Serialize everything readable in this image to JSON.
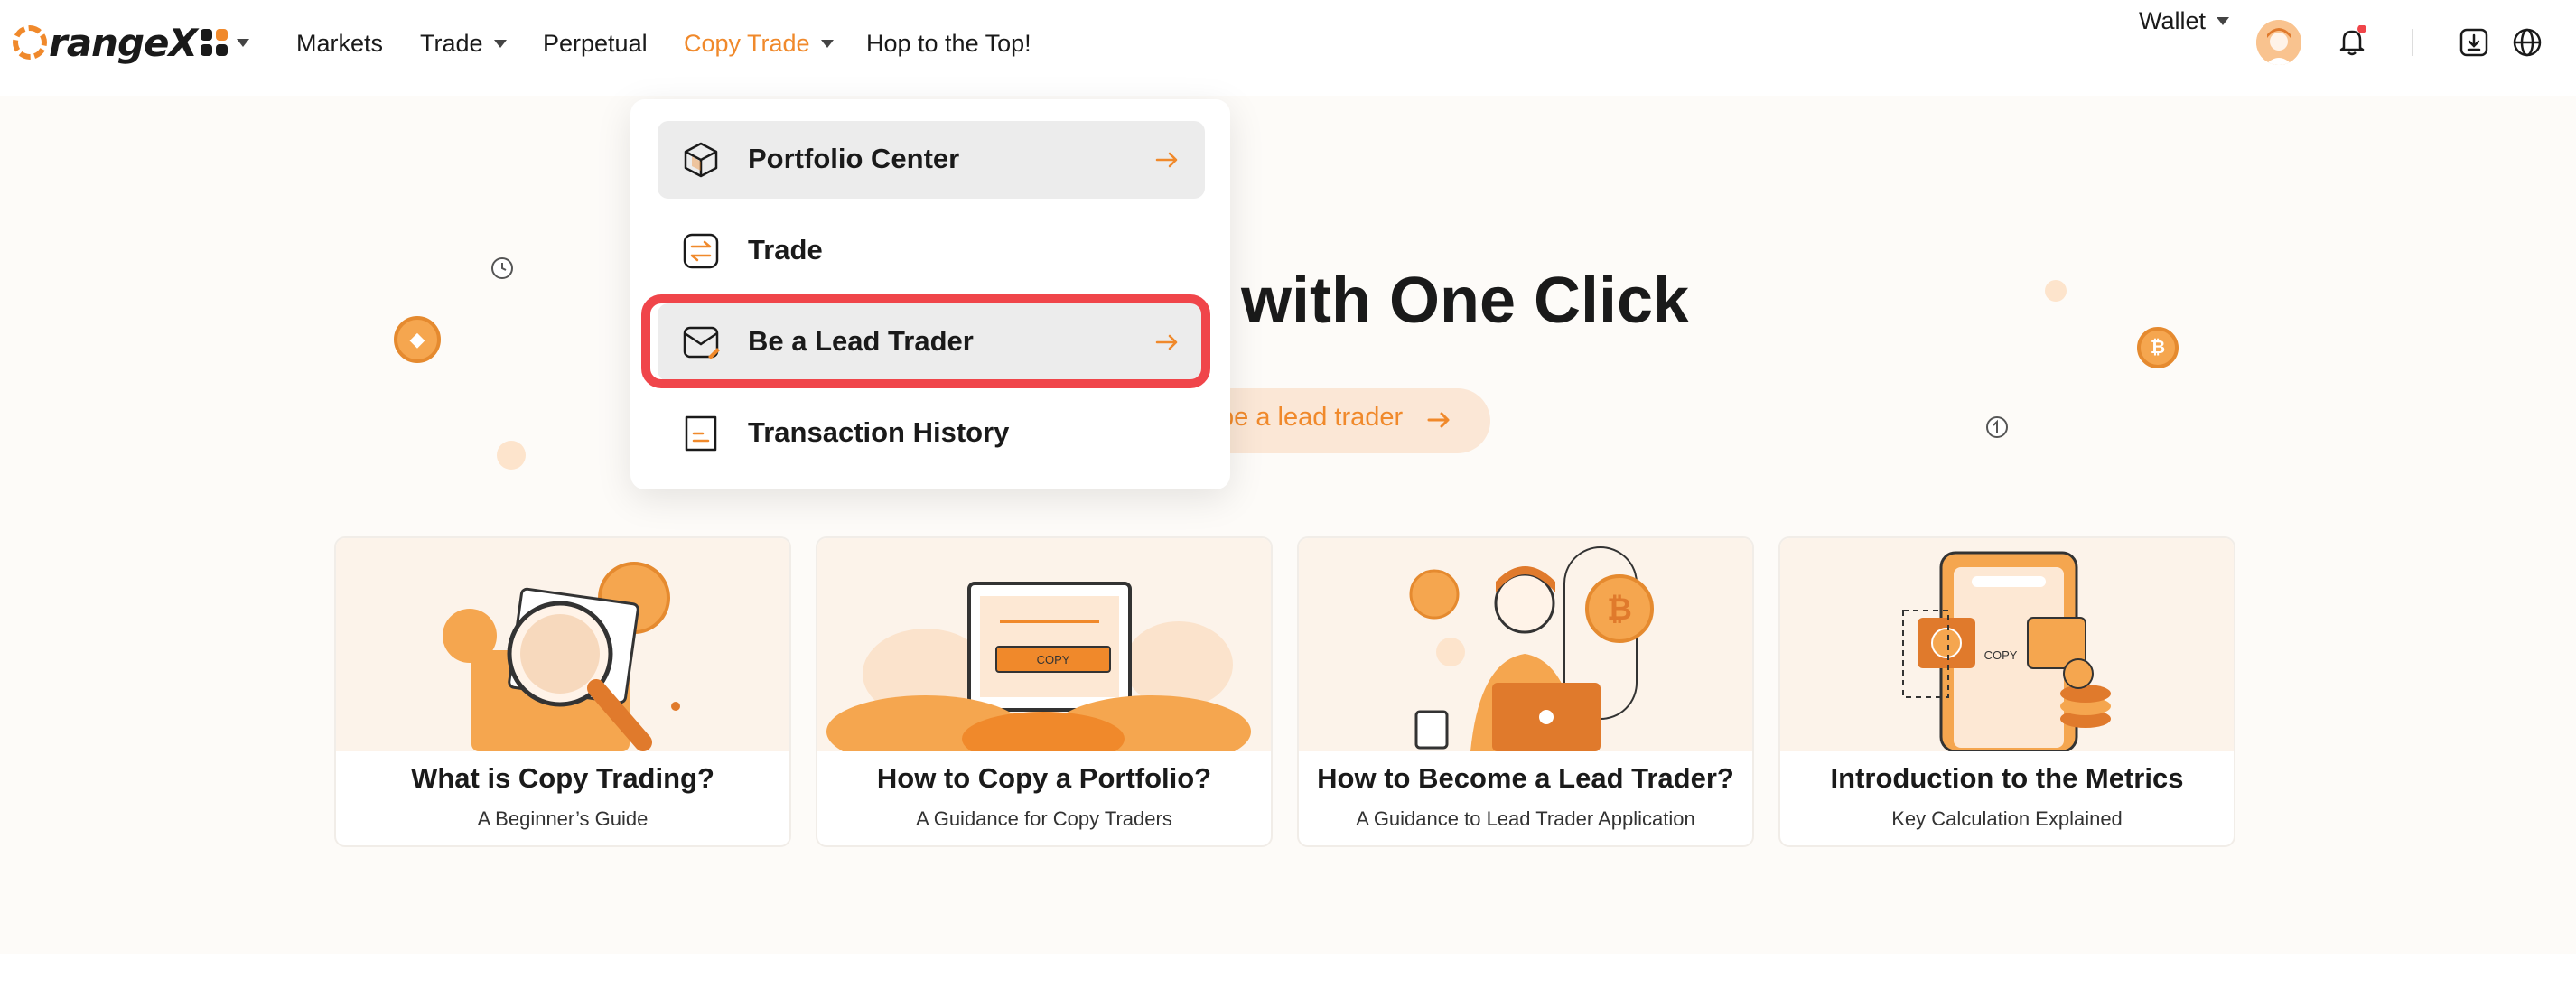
{
  "brand": {
    "logo_text": "rangeX",
    "accent": "#f0892b",
    "highlight": "#f0454a"
  },
  "nav": {
    "items": [
      {
        "label": "Markets",
        "has_caret": false
      },
      {
        "label": "Trade",
        "has_caret": true
      },
      {
        "label": "Perpetual",
        "has_caret": false
      },
      {
        "label": "Copy Trade",
        "has_caret": true,
        "active": true
      },
      {
        "label": "Hop to the Top!",
        "has_caret": false
      }
    ],
    "apps_icon": "apps-grid-icon"
  },
  "header_right": {
    "wallet_label": "Wallet",
    "icons": [
      "avatar",
      "bell-icon",
      "download-icon",
      "globe-icon"
    ],
    "notification_dot": true
  },
  "dropdown": {
    "items": [
      {
        "label": "Portfolio Center",
        "icon": "cube-icon",
        "hovered": true,
        "arrow": true
      },
      {
        "label": "Trade",
        "icon": "swap-icon",
        "hovered": false,
        "arrow": false
      },
      {
        "label": "Be a Lead Trader",
        "icon": "mail-edit-icon",
        "hovered": true,
        "arrow": true,
        "highlighted": true
      },
      {
        "label": "Transaction History",
        "icon": "document-icon",
        "hovered": false,
        "arrow": false
      }
    ]
  },
  "hero": {
    "title_visible": "with One Click",
    "cta_visible": "be a lead trader"
  },
  "cards": [
    {
      "title": "What is Copy Trading?",
      "subtitle": "A Beginner’s Guide"
    },
    {
      "title": "How to Copy a Portfolio?",
      "subtitle": "A Guidance for Copy Traders",
      "art_text": "COPY"
    },
    {
      "title": "How to Become a Lead Trader?",
      "subtitle": "A Guidance to Lead Trader Application"
    },
    {
      "title": "Introduction to the Metrics",
      "subtitle": "Key Calculation Explained",
      "art_text": "COPY"
    }
  ]
}
